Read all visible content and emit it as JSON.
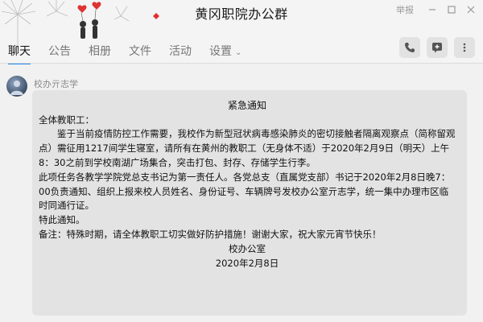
{
  "window": {
    "title": "黄冈职院办公群",
    "report_label": "举报"
  },
  "tabs": [
    {
      "label": "聊天"
    },
    {
      "label": "公告"
    },
    {
      "label": "相册"
    },
    {
      "label": "文件"
    },
    {
      "label": "活动"
    },
    {
      "label": "设置"
    }
  ],
  "message": {
    "sender": "校办亓志学",
    "title": "紧急通知",
    "greeting": "全体教职工：",
    "paragraph1": "鉴于当前疫情防控工作需要，我校作为新型冠状病毒感染肺炎的密切接触者隔离观察点（简称留观点）需征用1217间学生寝室，请所有在黄州的教职工（无身体不适）于2020年2月9日（明天）上午8：30之前到学校南湖广场集合，突击打包、封存、存储学生行李。",
    "paragraph2": "此项任务各教学学院党总支书记为第一责任人。各党总支（直属党支部）书记于2020年2月8日晚7：00负责通知、组织上报来校人员姓名、身份证号、车辆牌号发校办公室亓志学，统一集中办理市区临时同通行证。",
    "closing": "特此通知。",
    "note": "备注：特殊时期，请全体教职工切实做好防护措施！谢谢大家，祝大家元宵节快乐！",
    "signature": "校办公室",
    "date": "2020年2月8日"
  },
  "colors": {
    "accent": "#1f84ee",
    "bubble": "#e3e3e3",
    "background": "#f1f1f1"
  },
  "icons": [
    "phone-icon",
    "add-icon",
    "more-icon",
    "minimize-icon",
    "maximize-icon",
    "close-icon",
    "chevron-down-icon"
  ]
}
